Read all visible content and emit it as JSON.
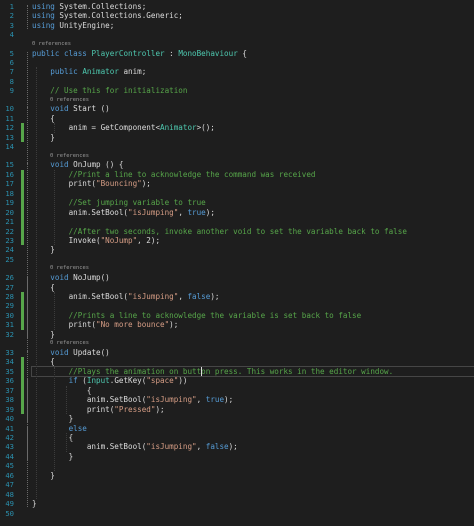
{
  "editor": {
    "theme_colors": {
      "background": "#1e1e1e",
      "keyword": "#569cd6",
      "type": "#4ec9b0",
      "string": "#d69d85",
      "comment": "#57a64a",
      "line_number": "#2b91af",
      "change_marker": "#57a64a",
      "codelens": "#999999"
    },
    "lines": [
      {
        "n": "1",
        "tokens": [
          [
            "kw",
            "using"
          ],
          [
            "pl",
            " System.Collections;"
          ]
        ]
      },
      {
        "n": "2",
        "tokens": [
          [
            "kw",
            "using"
          ],
          [
            "pl",
            " System.Collections.Generic;"
          ]
        ]
      },
      {
        "n": "3",
        "tokens": [
          [
            "kw",
            "using"
          ],
          [
            "pl",
            " UnityEngine;"
          ]
        ]
      },
      {
        "n": "4",
        "tokens": []
      },
      {
        "n": "5",
        "tokens": [
          [
            "kw",
            "public"
          ],
          [
            "pl",
            " "
          ],
          [
            "kw",
            "class"
          ],
          [
            "pl",
            " "
          ],
          [
            "type",
            "PlayerController"
          ],
          [
            "pl",
            " : "
          ],
          [
            "type",
            "MonoBehaviour"
          ],
          [
            "pl",
            " {"
          ]
        ]
      },
      {
        "n": "6",
        "tokens": []
      },
      {
        "n": "7",
        "tokens": [
          [
            "pl",
            "    "
          ],
          [
            "kw",
            "public"
          ],
          [
            "pl",
            " "
          ],
          [
            "type",
            "Animator"
          ],
          [
            "pl",
            " anim;"
          ]
        ]
      },
      {
        "n": "8",
        "tokens": []
      },
      {
        "n": "9",
        "tokens": [
          [
            "pl",
            "    "
          ],
          [
            "cmt",
            "// Use this for initialization"
          ]
        ]
      },
      {
        "n": "10",
        "tokens": [
          [
            "pl",
            "    "
          ],
          [
            "kw",
            "void"
          ],
          [
            "pl",
            " Start ()"
          ]
        ]
      },
      {
        "n": "11",
        "tokens": [
          [
            "pl",
            "    {"
          ]
        ]
      },
      {
        "n": "12",
        "tokens": [
          [
            "pl",
            "        anim = GetComponent<"
          ],
          [
            "type",
            "Animator"
          ],
          [
            "pl",
            ">();"
          ]
        ]
      },
      {
        "n": "13",
        "tokens": [
          [
            "pl",
            "    }"
          ]
        ]
      },
      {
        "n": "14",
        "tokens": []
      },
      {
        "n": "15",
        "tokens": [
          [
            "pl",
            "    "
          ],
          [
            "kw",
            "void"
          ],
          [
            "pl",
            " OnJump () {"
          ]
        ]
      },
      {
        "n": "16",
        "tokens": [
          [
            "pl",
            "        "
          ],
          [
            "cmt",
            "//Print a line to acknowledge the command was received"
          ]
        ]
      },
      {
        "n": "17",
        "tokens": [
          [
            "pl",
            "        print("
          ],
          [
            "str",
            "\"Bouncing\""
          ],
          [
            "pl",
            ");"
          ]
        ]
      },
      {
        "n": "18",
        "tokens": []
      },
      {
        "n": "19",
        "tokens": [
          [
            "pl",
            "        "
          ],
          [
            "cmt",
            "//Set jumping variable to true"
          ]
        ]
      },
      {
        "n": "20",
        "tokens": [
          [
            "pl",
            "        anim.SetBool("
          ],
          [
            "str",
            "\"isJumping\""
          ],
          [
            "pl",
            ", "
          ],
          [
            "kw",
            "true"
          ],
          [
            "pl",
            ");"
          ]
        ]
      },
      {
        "n": "21",
        "tokens": []
      },
      {
        "n": "22",
        "tokens": [
          [
            "pl",
            "        "
          ],
          [
            "cmt",
            "//After two seconds, invoke another void to set the variable back to false"
          ]
        ]
      },
      {
        "n": "23",
        "tokens": [
          [
            "pl",
            "        Invoke("
          ],
          [
            "str",
            "\"NoJump\""
          ],
          [
            "pl",
            ", 2);"
          ]
        ]
      },
      {
        "n": "24",
        "tokens": [
          [
            "pl",
            "    }"
          ]
        ]
      },
      {
        "n": "25",
        "tokens": []
      },
      {
        "n": "26",
        "tokens": [
          [
            "pl",
            "    "
          ],
          [
            "kw",
            "void"
          ],
          [
            "pl",
            " NoJump()"
          ]
        ]
      },
      {
        "n": "27",
        "tokens": [
          [
            "pl",
            "    {"
          ]
        ]
      },
      {
        "n": "28",
        "tokens": [
          [
            "pl",
            "        anim.SetBool("
          ],
          [
            "str",
            "\"isJumping\""
          ],
          [
            "pl",
            ", "
          ],
          [
            "kw",
            "false"
          ],
          [
            "pl",
            ");"
          ]
        ]
      },
      {
        "n": "29",
        "tokens": []
      },
      {
        "n": "30",
        "tokens": [
          [
            "pl",
            "        "
          ],
          [
            "cmt",
            "//Prints a line to acknowledge the variable is set back to false"
          ]
        ]
      },
      {
        "n": "31",
        "tokens": [
          [
            "pl",
            "        print("
          ],
          [
            "str",
            "\"No more bounce\""
          ],
          [
            "pl",
            ");"
          ]
        ]
      },
      {
        "n": "32",
        "tokens": [
          [
            "pl",
            "    }"
          ]
        ]
      },
      {
        "n": "33",
        "tokens": [
          [
            "pl",
            "    "
          ],
          [
            "kw",
            "void"
          ],
          [
            "pl",
            " Update()"
          ]
        ]
      },
      {
        "n": "34",
        "tokens": [
          [
            "pl",
            "    {"
          ]
        ]
      },
      {
        "n": "35",
        "tokens": [
          [
            "pl",
            "        "
          ],
          [
            "cmt",
            "//Plays the animation on button press. This works in the editor window."
          ]
        ]
      },
      {
        "n": "36",
        "tokens": [
          [
            "pl",
            "        "
          ],
          [
            "kw",
            "if"
          ],
          [
            "pl",
            " ("
          ],
          [
            "type",
            "Input"
          ],
          [
            "pl",
            ".GetKey("
          ],
          [
            "str",
            "\"space\""
          ],
          [
            "pl",
            "))"
          ]
        ]
      },
      {
        "n": "37",
        "tokens": [
          [
            "pl",
            "            {"
          ]
        ]
      },
      {
        "n": "38",
        "tokens": [
          [
            "pl",
            "            anim.SetBool("
          ],
          [
            "str",
            "\"isJumping\""
          ],
          [
            "pl",
            ", "
          ],
          [
            "kw",
            "true"
          ],
          [
            "pl",
            ");"
          ]
        ]
      },
      {
        "n": "39",
        "tokens": [
          [
            "pl",
            "            print("
          ],
          [
            "str",
            "\"Pressed\""
          ],
          [
            "pl",
            ");"
          ]
        ]
      },
      {
        "n": "40",
        "tokens": [
          [
            "pl",
            "        }"
          ]
        ]
      },
      {
        "n": "41",
        "tokens": [
          [
            "pl",
            "        "
          ],
          [
            "kw",
            "else"
          ]
        ]
      },
      {
        "n": "42",
        "tokens": [
          [
            "pl",
            "        {"
          ]
        ]
      },
      {
        "n": "43",
        "tokens": [
          [
            "pl",
            "            anim.SetBool("
          ],
          [
            "str",
            "\"isJumping\""
          ],
          [
            "pl",
            ", "
          ],
          [
            "kw",
            "false"
          ],
          [
            "pl",
            ");"
          ]
        ]
      },
      {
        "n": "44",
        "tokens": [
          [
            "pl",
            "        }"
          ]
        ]
      },
      {
        "n": "45",
        "tokens": []
      },
      {
        "n": "46",
        "tokens": [
          [
            "pl",
            "    }"
          ]
        ]
      },
      {
        "n": "47",
        "tokens": []
      },
      {
        "n": "48",
        "tokens": []
      },
      {
        "n": "49",
        "tokens": [
          [
            "pl",
            "}"
          ]
        ]
      },
      {
        "n": "50",
        "tokens": []
      }
    ],
    "codelens": [
      {
        "before_line": "5",
        "text": "0 references"
      },
      {
        "before_line": "10",
        "text": "0 references"
      },
      {
        "before_line": "15",
        "text": "0 references"
      },
      {
        "before_line": "26",
        "text": "0 references"
      },
      {
        "before_line": "33",
        "text": "0 references"
      }
    ],
    "current_line": "35",
    "changed_lines": [
      "12",
      "13",
      "16",
      "17",
      "18",
      "19",
      "20",
      "21",
      "22",
      "23",
      "28",
      "29",
      "30",
      "31",
      "34",
      "35",
      "36",
      "37",
      "38",
      "39"
    ]
  }
}
